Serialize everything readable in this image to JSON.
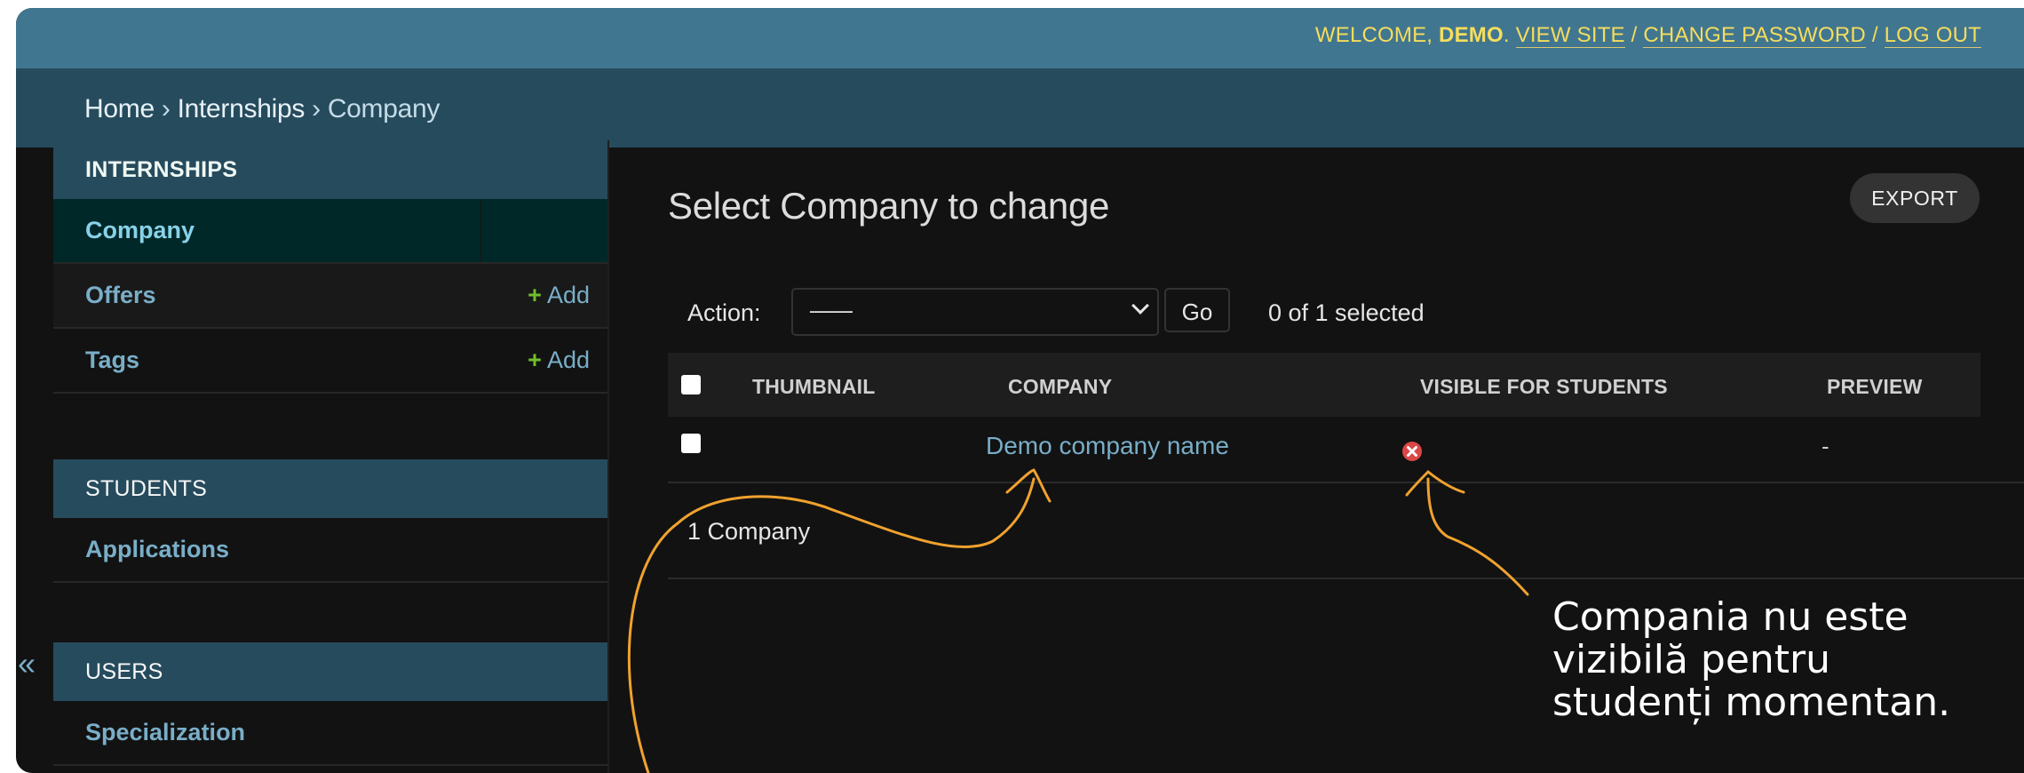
{
  "header": {
    "welcome": "WELCOME, ",
    "username": "DEMO",
    "dot": ". ",
    "view_site": "VIEW SITE",
    "slash": " / ",
    "change_password": "CHANGE PASSWORD",
    "log_out": "LOG OUT"
  },
  "breadcrumb": {
    "home": "Home",
    "separator": " › ",
    "internships": "Internships",
    "current": "Company"
  },
  "sidebar": {
    "modules": [
      {
        "caption": "INTERNSHIPS",
        "items": [
          {
            "label": "Company",
            "current": true
          },
          {
            "label": "Offers",
            "add": "Add"
          },
          {
            "label": "Tags",
            "add": "Add"
          }
        ]
      },
      {
        "caption": "STUDENTS",
        "items": [
          {
            "label": "Applications"
          }
        ]
      },
      {
        "caption": "USERS",
        "items": [
          {
            "label": "Specialization"
          }
        ]
      }
    ],
    "add_plus": "+",
    "collapse_glyph": "«"
  },
  "content": {
    "title": "Select Company to change",
    "export_label": "EXPORT",
    "action_label": "Action:",
    "action_selected": "---------",
    "go_label": "Go",
    "selected_count": "0 of 1 selected",
    "columns": [
      "THUMBNAIL",
      "COMPANY",
      "VISIBLE FOR STUDENTS",
      "PREVIEW"
    ],
    "rows": [
      {
        "thumbnail": "",
        "company": "Demo company name",
        "visible": false,
        "preview": "-"
      }
    ],
    "result_count": "1 Company"
  },
  "annotation": {
    "text": "Compania nu este\nvizibilă pentru\nstudenți momentan.",
    "stroke_color": "#f0a22e"
  },
  "colors": {
    "header_bg": "#417690",
    "breadcrumb_bg": "#264b5d",
    "link": "#79aec8",
    "accent_yellow": "#f5dd5d",
    "add_green": "#70bf2b",
    "false_icon": "#dd4646"
  }
}
